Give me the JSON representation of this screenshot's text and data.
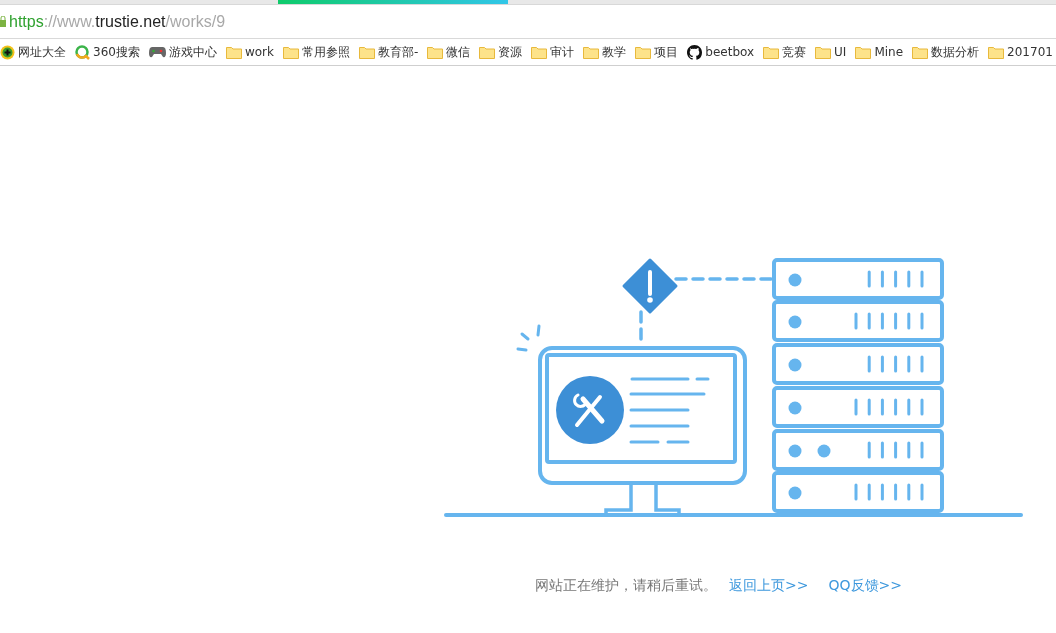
{
  "address_bar": {
    "scheme": "https",
    "prefix": "://www.",
    "host": "trustie.net",
    "path": "/works/9"
  },
  "bookmarks": [
    {
      "label": "网址大全",
      "kind": "nav"
    },
    {
      "label": "360搜索",
      "kind": "search"
    },
    {
      "label": "游戏中心",
      "kind": "game"
    },
    {
      "label": "work",
      "kind": "folder"
    },
    {
      "label": "常用参照",
      "kind": "folder"
    },
    {
      "label": "教育部-",
      "kind": "folder"
    },
    {
      "label": "微信",
      "kind": "folder"
    },
    {
      "label": "资源",
      "kind": "folder"
    },
    {
      "label": "审计",
      "kind": "folder"
    },
    {
      "label": "教学",
      "kind": "folder"
    },
    {
      "label": "项目",
      "kind": "folder"
    },
    {
      "label": "beetbox",
      "kind": "github"
    },
    {
      "label": "竞赛",
      "kind": "folder"
    },
    {
      "label": "UI",
      "kind": "folder"
    },
    {
      "label": "Mine",
      "kind": "folder"
    },
    {
      "label": "数据分析",
      "kind": "folder"
    },
    {
      "label": "201701",
      "kind": "folder"
    }
  ],
  "message": {
    "text": "网站正在维护，请稍后重试。",
    "links": [
      "返回上页>>",
      "QQ反馈>>"
    ]
  }
}
